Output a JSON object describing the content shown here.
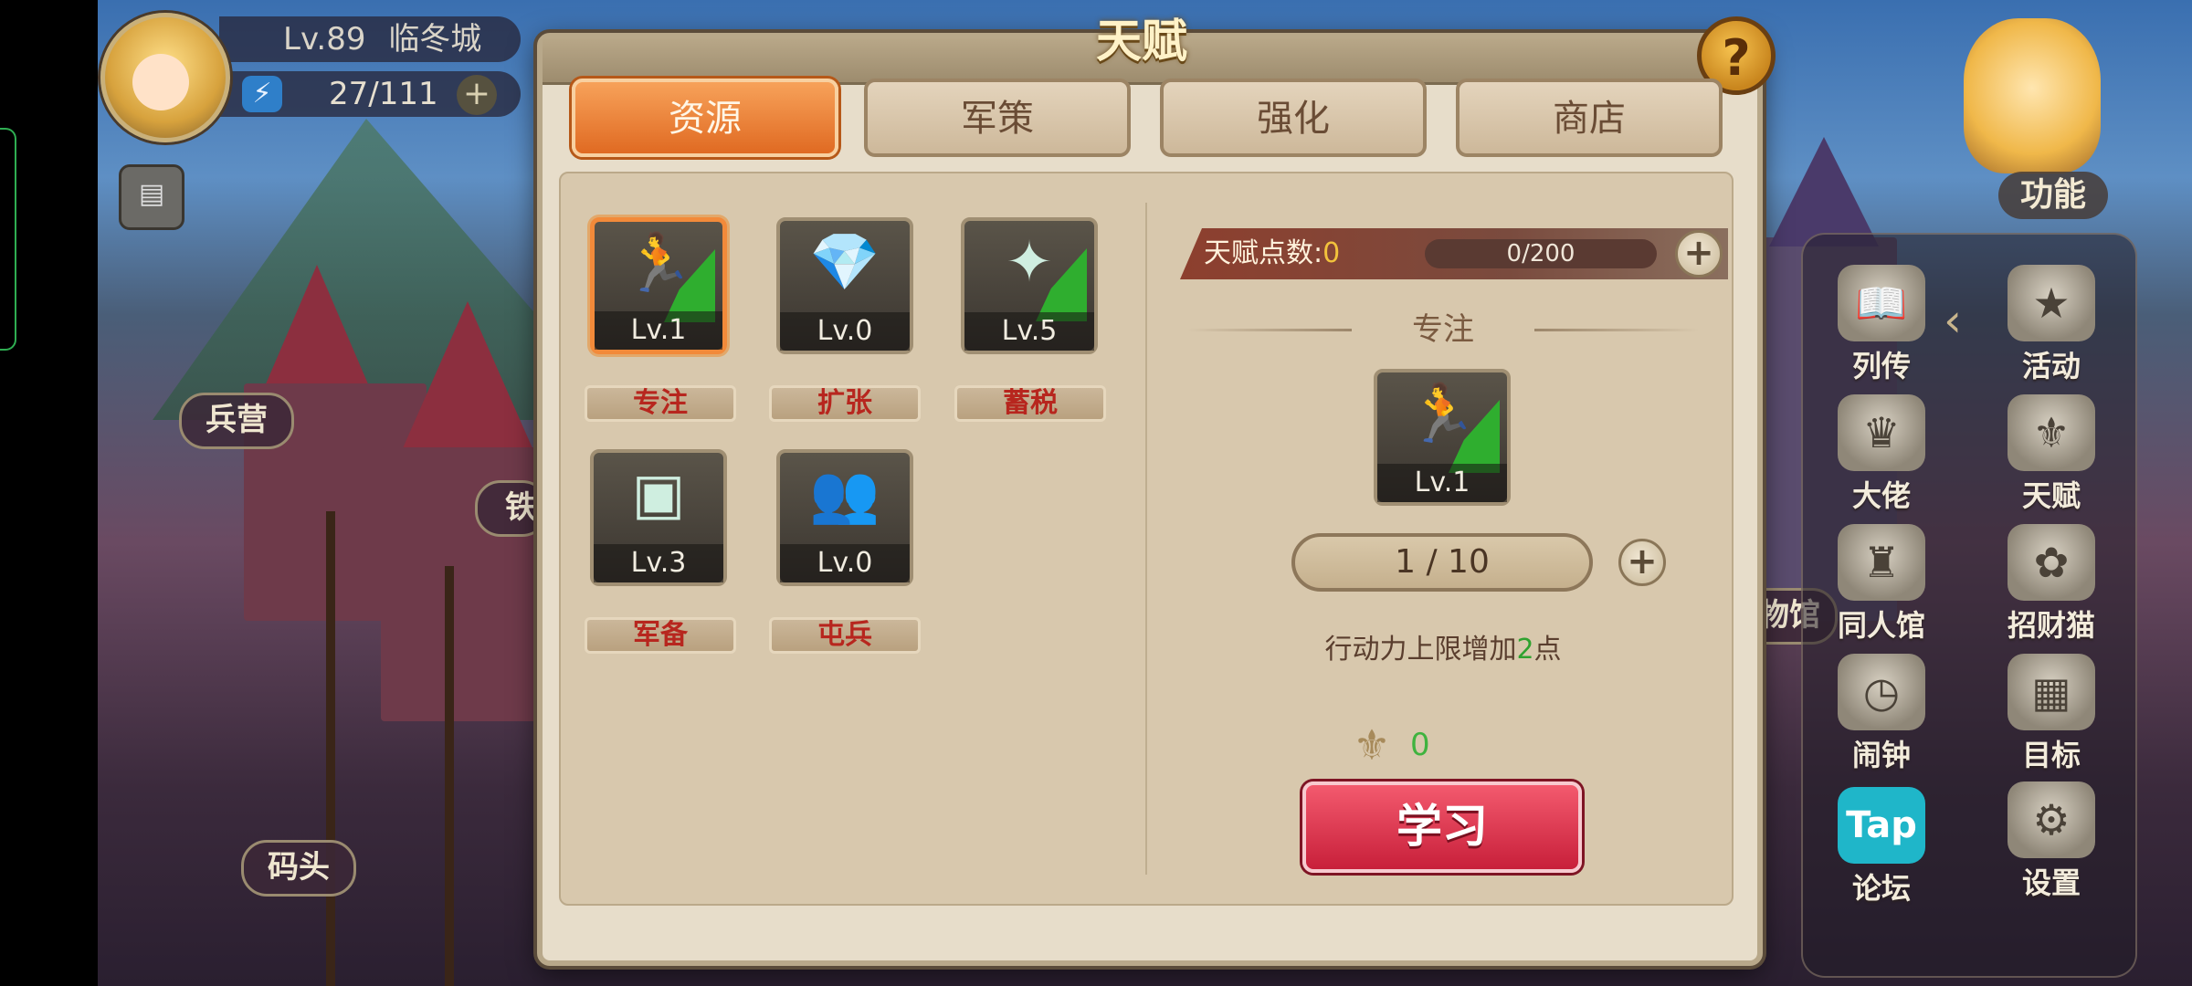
{
  "hud": {
    "level": "Lv.89",
    "city": "临冬城",
    "energy": "27/111",
    "energy_plus": "+"
  },
  "map_labels": {
    "barracks": "兵营",
    "dock": "码头",
    "partial_left": "铁",
    "partial_right": "物馆"
  },
  "function_panel": {
    "title": "功能",
    "items": [
      {
        "label": "列传",
        "icon": "book-icon"
      },
      {
        "label": "活动",
        "icon": "star-badge-icon"
      },
      {
        "label": "大佬",
        "icon": "boss-icon"
      },
      {
        "label": "天赋",
        "icon": "talent-icon"
      },
      {
        "label": "同人馆",
        "icon": "castle-icon"
      },
      {
        "label": "招财猫",
        "icon": "lucky-cat-icon"
      },
      {
        "label": "闹钟",
        "icon": "clock-icon"
      },
      {
        "label": "目标",
        "icon": "target-scroll-icon"
      },
      {
        "label": "论坛",
        "icon": "taptap-icon",
        "icon_text": "Tap"
      },
      {
        "label": "设置",
        "icon": "gear-icon"
      }
    ]
  },
  "dialog": {
    "title": "天赋",
    "help": "?",
    "tabs": [
      {
        "label": "资源",
        "active": true
      },
      {
        "label": "军策",
        "active": false
      },
      {
        "label": "强化",
        "active": false
      },
      {
        "label": "商店",
        "active": false
      }
    ],
    "talents": [
      {
        "name": "专注",
        "level": "Lv.1",
        "icon": "running-figure-icon",
        "selected": true
      },
      {
        "name": "扩张",
        "level": "Lv.0",
        "icon": "crystals-icon",
        "selected": false
      },
      {
        "name": "蓄税",
        "level": "Lv.5",
        "icon": "coins-icon",
        "selected": false
      },
      {
        "name": "军备",
        "level": "Lv.3",
        "icon": "treasure-chest-icon",
        "selected": false
      },
      {
        "name": "屯兵",
        "level": "Lv.0",
        "icon": "soldiers-icon",
        "selected": false
      }
    ],
    "points": {
      "label": "天赋点数:",
      "value": "0",
      "progress": "0/200",
      "plus": "+"
    },
    "detail": {
      "title": "专注",
      "level": "Lv.1",
      "progress": "1 / 10",
      "plus": "+",
      "desc_prefix": "行动力上限增加",
      "desc_num": "2",
      "desc_suffix": "点",
      "cost": "0",
      "learn_label": "学习"
    }
  },
  "colors": {
    "accent_orange": "#e06a22",
    "learn_red": "#c81f3a",
    "talent_green": "#2fae2f",
    "label_red": "#b7261e"
  }
}
